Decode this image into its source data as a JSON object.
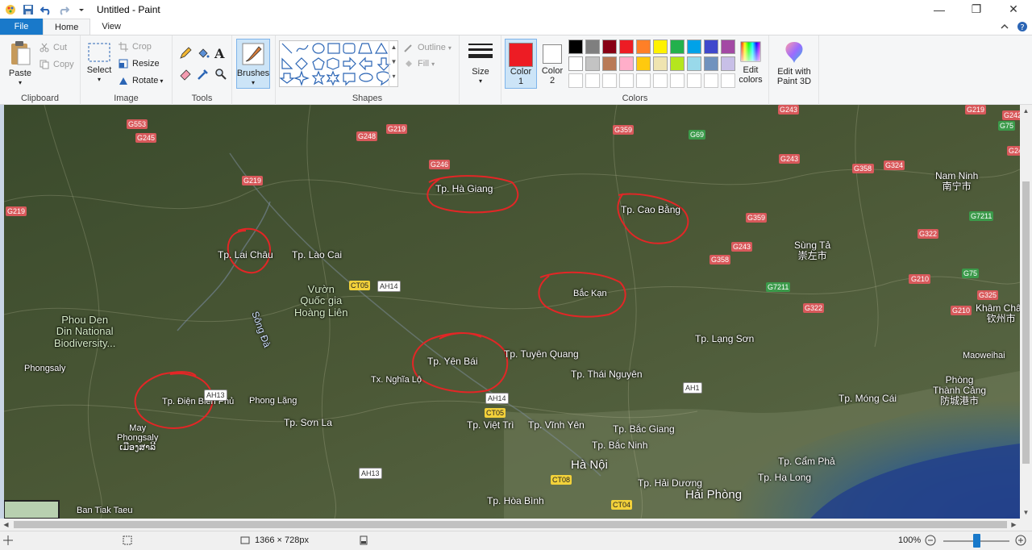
{
  "window": {
    "title": "Untitled - Paint",
    "minimize": "—",
    "maximize": "❐",
    "close": "✕"
  },
  "tabs": {
    "file": "File",
    "home": "Home",
    "view": "View"
  },
  "ribbon": {
    "clipboard": {
      "label": "Clipboard",
      "paste": "Paste",
      "cut": "Cut",
      "copy": "Copy"
    },
    "image": {
      "label": "Image",
      "select": "Select",
      "crop": "Crop",
      "resize": "Resize",
      "rotate": "Rotate"
    },
    "tools": {
      "label": "Tools"
    },
    "brushes": {
      "label": "Brushes"
    },
    "shapes": {
      "label": "Shapes",
      "outline": "Outline",
      "fill": "Fill"
    },
    "size": {
      "label": "Size"
    },
    "colors": {
      "label": "Colors",
      "color1": "Color 1",
      "color2": "Color 2",
      "edit_colors": "Edit colors",
      "color1_value": "#ed1c24",
      "color2_value": "#ffffff",
      "palette_row1": [
        "#000000",
        "#7f7f7f",
        "#880015",
        "#ed1c24",
        "#ff7f27",
        "#fff200",
        "#22b14c",
        "#00a2e8",
        "#3f48cc",
        "#a349a4"
      ],
      "palette_row2": [
        "#ffffff",
        "#c3c3c3",
        "#b97a57",
        "#ffaec9",
        "#ffc90e",
        "#efe4b0",
        "#b5e61d",
        "#99d9ea",
        "#7092be",
        "#c8bfe7"
      ],
      "palette_row3": [
        "#ffffff",
        "#ffffff",
        "#ffffff",
        "#ffffff",
        "#ffffff",
        "#ffffff",
        "#ffffff",
        "#ffffff",
        "#ffffff",
        "#ffffff"
      ]
    },
    "edit3d": "Edit with Paint 3D"
  },
  "map": {
    "places": [
      {
        "id": "ha-giang",
        "text": "Tp. Hà Giang",
        "circled": true
      },
      {
        "id": "cao-bang",
        "text": "Tp. Cao Bằng",
        "circled": true
      },
      {
        "id": "lai-chau",
        "text": "Tp. Lai Châu",
        "circled": true
      },
      {
        "id": "lao-cai",
        "text": "Tp. Lào Cai",
        "circled": false
      },
      {
        "id": "bac-kan",
        "text": "Bắc Kạn",
        "circled": true
      },
      {
        "id": "yen-bai",
        "text": "Tp. Yên Bái",
        "circled": true
      },
      {
        "id": "tuyen-quang",
        "text": "Tp. Tuyên Quang",
        "circled": false
      },
      {
        "id": "dien-bien",
        "text": "Tp. Điện Biên Phủ",
        "circled": true
      },
      {
        "id": "thai-nguyen",
        "text": "Tp. Thái Nguyên",
        "circled": false
      },
      {
        "id": "lang-son",
        "text": "Tp. Lạng Sơn",
        "circled": false
      },
      {
        "id": "ha-noi",
        "text": "Hà Nội",
        "circled": false
      },
      {
        "id": "hai-phong",
        "text": "Hải Phòng",
        "circled": false
      },
      {
        "id": "bac-giang",
        "text": "Tp. Bắc Giang",
        "circled": false
      },
      {
        "id": "bac-ninh",
        "text": "Tp. Bắc Ninh",
        "circled": false
      },
      {
        "id": "vinh-yen",
        "text": "Tp. Vĩnh Yên",
        "circled": false
      },
      {
        "id": "viet-tri",
        "text": "Tp. Việt Trì",
        "circled": false
      },
      {
        "id": "son-la",
        "text": "Tp. Sơn La",
        "circled": false
      },
      {
        "id": "phong-lang",
        "text": "Phong Lặng",
        "circled": false
      },
      {
        "id": "nghia-lo",
        "text": "Tx. Nghĩa Lộ",
        "circled": false
      },
      {
        "id": "mong-cai",
        "text": "Tp. Móng Cái",
        "circled": false
      },
      {
        "id": "cam-pha",
        "text": "Tp. Cẩm Phả",
        "circled": false
      },
      {
        "id": "ha-long",
        "text": "Tp. Hạ Long",
        "circled": false
      },
      {
        "id": "hai-duong",
        "text": "Tp. Hải Dương",
        "circled": false
      },
      {
        "id": "hoa-binh",
        "text": "Tp. Hòa Bình",
        "circled": false
      },
      {
        "id": "nanning",
        "text": "Nam Ninh\n南宁市",
        "circled": false
      },
      {
        "id": "chongzuo",
        "text": "Sùng Tả\n崇左市",
        "circled": false
      },
      {
        "id": "khamchau",
        "text": "Khâm Châu\n钦州市",
        "circled": false
      },
      {
        "id": "fangcheng",
        "text": "Phòng\nThành Cảng\n防城港市",
        "circled": false
      },
      {
        "id": "maoweihai",
        "text": "Maoweihai",
        "circled": false
      },
      {
        "id": "hoang-lien",
        "text": "Vườn\nQuốc gia\nHoàng Liên",
        "circled": false
      },
      {
        "id": "phou-den-din",
        "text": "Phou Den\nDin National\nBiodiversity...",
        "circled": false
      },
      {
        "id": "phongsaly",
        "text": "Phongsaly",
        "circled": false
      },
      {
        "id": "may-phongsaly",
        "text": "May\nPhongsaly\nເມືອງສາລີ",
        "circled": false
      },
      {
        "id": "ban-tiak",
        "text": "Ban Tiak Taeu",
        "circled": false
      },
      {
        "id": "song-da",
        "text": "Sông Đà",
        "circled": false
      }
    ],
    "roads": [
      "G553",
      "G245",
      "G219",
      "G219",
      "G248",
      "G219",
      "G246",
      "G359",
      "G69",
      "G75",
      "G243",
      "G242",
      "G358",
      "G242",
      "G243",
      "G358",
      "G324",
      "G359",
      "G7211",
      "G243",
      "G358",
      "G322",
      "G75",
      "G7211",
      "G322",
      "G210",
      "G325",
      "G210",
      "CT05",
      "AH14",
      "AH13",
      "AH14",
      "CT05",
      "AH1",
      "CT08",
      "CT04",
      "AH13",
      "G219",
      "G210"
    ]
  },
  "status": {
    "dimensions": "1366 × 728px",
    "zoom": "100%"
  }
}
